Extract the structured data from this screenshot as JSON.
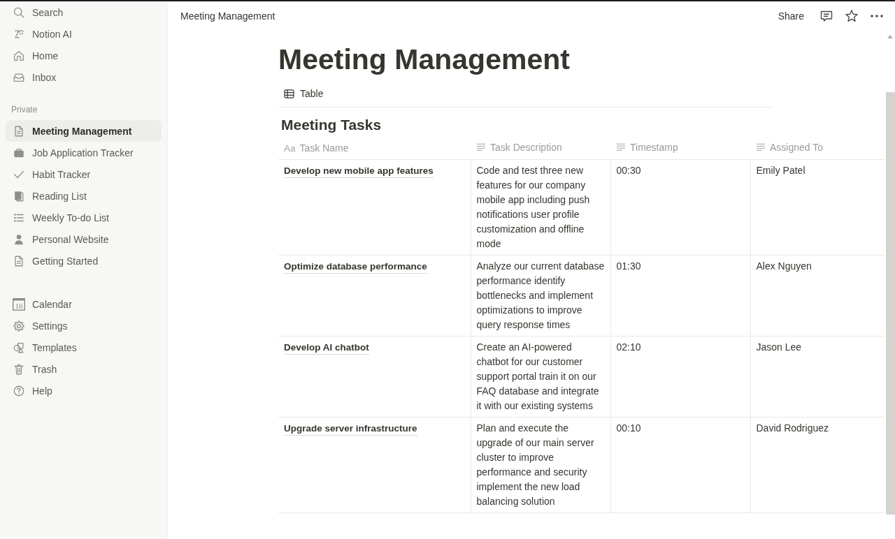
{
  "sidebar": {
    "top_items": [
      {
        "label": "Search"
      },
      {
        "label": "Notion AI"
      },
      {
        "label": "Home"
      },
      {
        "label": "Inbox"
      }
    ],
    "private": {
      "heading": "Private",
      "pages": [
        {
          "label": "Meeting Management",
          "selected": true
        },
        {
          "label": "Job Application Tracker",
          "selected": false
        },
        {
          "label": "Habit Tracker",
          "selected": false
        },
        {
          "label": "Reading List",
          "selected": false
        },
        {
          "label": "Weekly To-do List",
          "selected": false
        },
        {
          "label": "Personal Website",
          "selected": false
        },
        {
          "label": "Getting Started",
          "selected": false
        }
      ]
    },
    "bottom_items": [
      {
        "label": "Calendar",
        "date": "16"
      },
      {
        "label": "Settings"
      },
      {
        "label": "Templates"
      },
      {
        "label": "Trash"
      },
      {
        "label": "Help"
      }
    ]
  },
  "topbar": {
    "breadcrumb": "Meeting Management",
    "share": "Share"
  },
  "page": {
    "title": "Meeting Management",
    "views": [
      {
        "label": "Table"
      }
    ],
    "database": {
      "title": "Meeting Tasks",
      "columns": [
        {
          "label": "Task Name",
          "kind": "title",
          "glyph": "Aa"
        },
        {
          "label": "Task Description",
          "kind": "text"
        },
        {
          "label": "Timestamp",
          "kind": "text"
        },
        {
          "label": "Assigned To",
          "kind": "text"
        }
      ],
      "rows": [
        {
          "cells": [
            "Develop new mobile app features",
            "Code and test three new features for our company mobile app including push notifications user profile customization and offline mode",
            "00:30",
            "Emily Patel"
          ]
        },
        {
          "cells": [
            "Optimize database performance",
            "Analyze our current database performance identify bottlenecks and implement optimizations to improve query response times",
            "01:30",
            "Alex Nguyen"
          ]
        },
        {
          "cells": [
            "Develop AI chatbot",
            "Create an AI-powered chatbot for our customer support portal train it on our FAQ database and integrate it with our existing systems",
            "02:10",
            "Jason Lee"
          ]
        },
        {
          "cells": [
            "Upgrade server infrastructure",
            "Plan and execute the upgrade of our main server cluster to improve performance and security implement the new load balancing solution",
            "00:10",
            "David Rodriguez"
          ]
        }
      ]
    }
  }
}
